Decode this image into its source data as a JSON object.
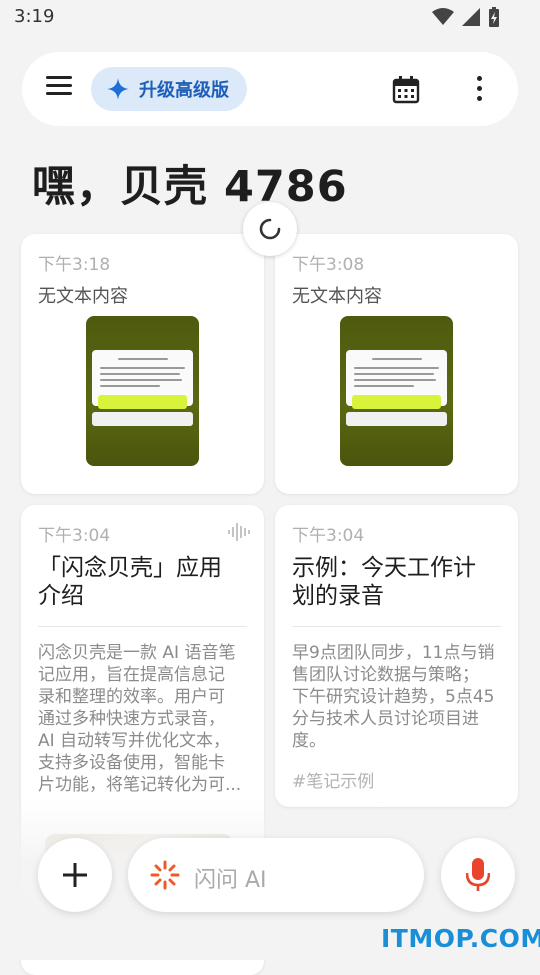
{
  "status_bar": {
    "time": "3:19"
  },
  "toolbar": {
    "upgrade_label": "升级高级版"
  },
  "greeting": "嘿，贝壳 4786",
  "cards": [
    {
      "time": "下午3:18",
      "subtitle": "无文本内容"
    },
    {
      "time": "下午3:08",
      "subtitle": "无文本内容"
    },
    {
      "time": "下午3:04",
      "title_lines": [
        "「闪念贝壳」应用",
        "介绍"
      ],
      "body_lines": [
        "闪念贝壳是一款 AI 语音笔",
        "记应用，旨在提高信息记",
        "录和整理的效率。用户可",
        "通过多种快速方式录音，",
        "AI 自动转写并优化文本，",
        "支持多设备使用，智能卡",
        "片功能，将笔记转化为可..."
      ]
    },
    {
      "time": "下午3:04",
      "title_lines": [
        "示例：今天工作计",
        "划的录音"
      ],
      "body_lines": [
        "早9点团队同步，11点与销",
        "售团队讨论数据与策略；",
        "下午研究设计趋势，5点45",
        "分与技术人员讨论项目进",
        "度。"
      ],
      "tag": "#笔记示例"
    }
  ],
  "bottom_bar": {
    "ask_label": "闪问 AI"
  },
  "watermark": "ITMOP.COM",
  "colors": {
    "accent": "#1f5fb8",
    "upgrade_bg": "#dbe9f9",
    "mic": "#e8452c",
    "ai_icon": "#f05a28"
  }
}
